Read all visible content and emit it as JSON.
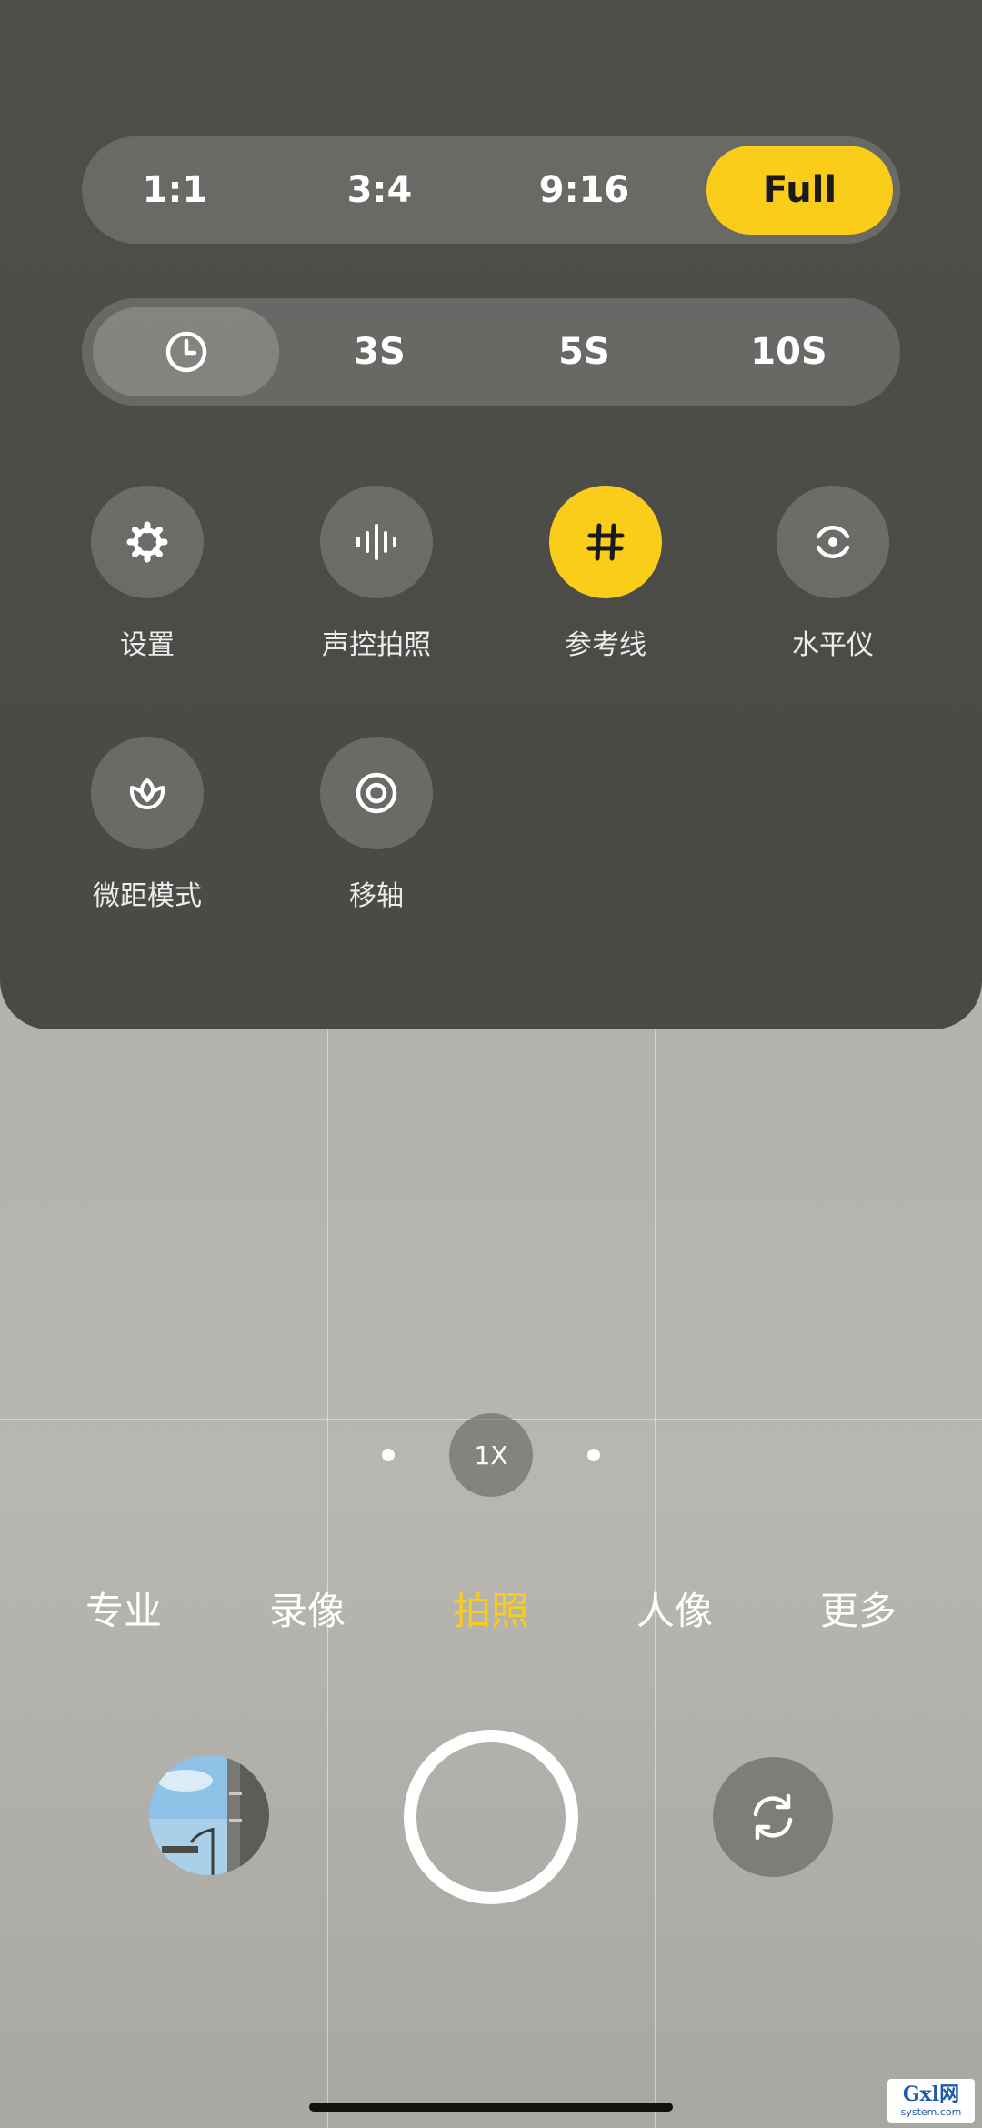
{
  "aspect_ratio": {
    "options": [
      "1:1",
      "3:4",
      "9:16",
      "Full"
    ],
    "selected": "Full"
  },
  "timer": {
    "options": [
      "clock-icon",
      "3S",
      "5S",
      "10S"
    ],
    "labels": {
      "t3": "3S",
      "t5": "5S",
      "t10": "10S"
    },
    "selected": "clock-icon"
  },
  "tools": {
    "settings": {
      "label": "设置",
      "icon": "gear-icon"
    },
    "voice": {
      "label": "声控拍照",
      "icon": "sound-wave-icon"
    },
    "grid": {
      "label": "参考线",
      "icon": "hash-icon",
      "active": true
    },
    "level": {
      "label": "水平仪",
      "icon": "level-icon"
    },
    "macro": {
      "label": "微距模式",
      "icon": "flower-icon"
    },
    "tilt": {
      "label": "移轴",
      "icon": "target-icon"
    }
  },
  "zoom": {
    "label": "1X"
  },
  "modes": {
    "pro": "专业",
    "video": "录像",
    "photo": "拍照",
    "portrait": "人像",
    "more": "更多",
    "selected": "拍照"
  },
  "colors": {
    "accent": "#f9cd19",
    "panel": "#4c4b47"
  },
  "watermark": {
    "top": "Gxl网",
    "bottom": "system.com"
  }
}
